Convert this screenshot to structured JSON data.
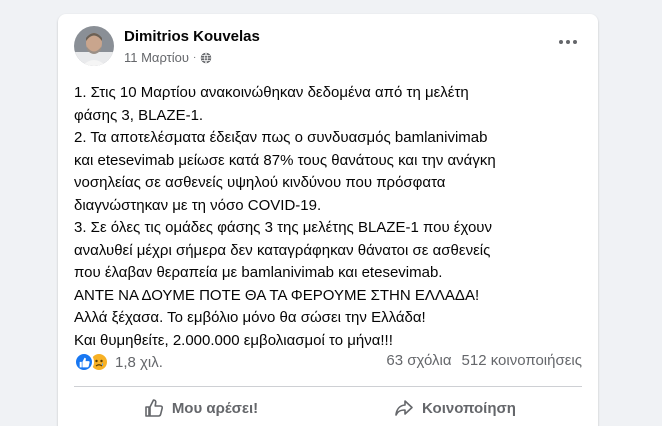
{
  "post": {
    "author": "Dimitrios Kouvelas",
    "date": "11 Μαρτίου",
    "separator": "·",
    "audience_icon": "globe-icon",
    "lines": [
      "1. Στις 10 Μαρτίου  ανακοινώθηκαν δεδομένα από τη μελέτη",
      "φάσης 3, BLAZE-1.",
      "2. Τα αποτελέσματα έδειξαν πως ο συνδυασμός bamlanivimab",
      "και etesevimab μείωσε κατά 87% τους θανάτους και την ανάγκη",
      "νοσηλείας σε ασθενείς υψηλού κινδύνου που πρόσφατα",
      "διαγνώστηκαν με τη νόσο COVID-19.",
      "3. Σε όλες τις ομάδες φάσης 3 της μελέτης BLAZE-1 που έχουν",
      "αναλυθεί μέχρι σήμερα δεν καταγράφηκαν θάνατοι σε ασθενείς",
      "που έλαβαν θεραπεία με bamlanivimab και etesevimab.",
      "ΑΝΤΕ ΝΑ ΔΟΥΜΕ ΠΟΤΕ ΘΑ ΤΑ ΦΕΡΟΥΜΕ ΣΤΗΝ ΕΛΛΑΔΑ!",
      "Αλλά ξέχασα. Το εμβόλιο μόνο θα σώσει την Ελλάδα!",
      "Και θυμηθείτε, 2.000.000 εμβολιασμοί το μήνα!!!"
    ]
  },
  "stats": {
    "reactions": "1,8 χιλ.",
    "reaction_icons": [
      "like-icon",
      "sad-icon"
    ],
    "comments": "63 σχόλια",
    "shares": "512 κοινοποιήσεις"
  },
  "actions": {
    "like": "Μου αρέσει!",
    "share": "Κοινοποίηση"
  },
  "colors": {
    "background": "#f0f2f5",
    "card": "#ffffff",
    "like_blue": "#1877f2",
    "sad_yellow": "#f7b125",
    "secondary_text": "#65676b"
  }
}
